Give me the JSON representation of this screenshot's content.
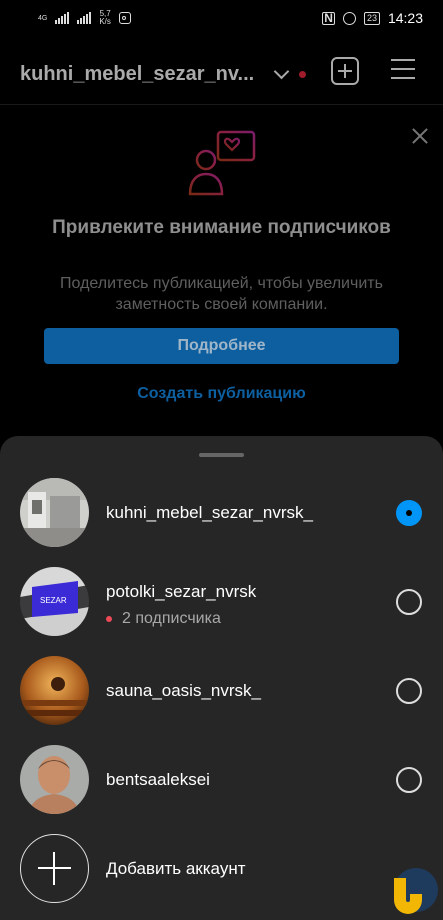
{
  "status_bar": {
    "network": "4G",
    "speed_value": "5,7",
    "speed_unit": "K/s",
    "battery": "23",
    "time": "14:23"
  },
  "header": {
    "username": "kuhni_mebel_sezar_nv...",
    "icons": [
      "chevron-down-icon",
      "new-post-icon",
      "menu-icon"
    ]
  },
  "promo": {
    "title": "Привлеките внимание подписчиков",
    "text": "Поделитесь публикацией, чтобы увеличить заметность своей компании.",
    "button": "Подробнее",
    "link": "Создать публикацию"
  },
  "sheet": {
    "accounts": [
      {
        "username": "kuhni_mebel_sezar_nvrsk_",
        "subtitle": "",
        "selected": true
      },
      {
        "username": "potolki_sezar_nvrsk",
        "subtitle": "2 подписчика",
        "selected": false
      },
      {
        "username": "sauna_oasis_nvrsk_",
        "subtitle": "",
        "selected": false
      },
      {
        "username": "bentsaaleksei",
        "subtitle": "",
        "selected": false
      }
    ],
    "add_account": "Добавить аккаунт",
    "avatar_logo_text": "SEZAR"
  },
  "colors": {
    "accent": "#0095f6",
    "promo_button": "#0d5fa0",
    "notification_dot": "#ed4956",
    "sheet_bg": "#262626"
  }
}
